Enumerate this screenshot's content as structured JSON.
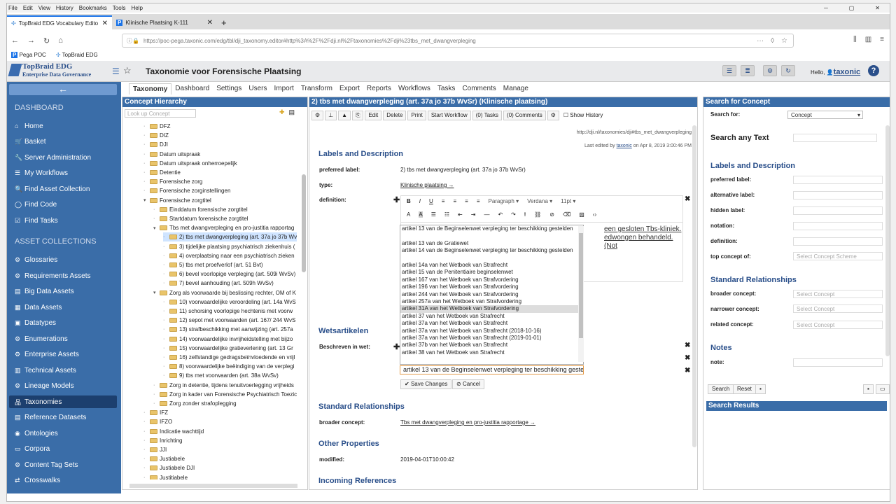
{
  "browser": {
    "menu": [
      "File",
      "Edit",
      "View",
      "History",
      "Bookmarks",
      "Tools",
      "Help"
    ],
    "tabs": [
      {
        "title": "TopBraid EDG Vocabulary Edito"
      },
      {
        "title": "Klinische Plaatsing K-111"
      }
    ],
    "new_tab": "+",
    "url": "https://poc-pega.taxonic.com/edg/tbl/dji_taxonomy.editor#http%3A%2F%2Fdji.nl%2Ftaxonomies%2Fdji%23tbs_met_dwangverpleging",
    "bookmarks": [
      "Pega POC",
      "TopBraid EDG"
    ]
  },
  "app": {
    "logo_line1": "TopBraid EDG",
    "logo_line2": "Enterprise Data Governance",
    "title": "Taxonomie voor Forensische Plaatsing",
    "hello": "Hello,",
    "user": "taxonic",
    "help": "?"
  },
  "sidebar": {
    "dashboard_head": "DASHBOARD",
    "dashboard": [
      "Home",
      "Basket",
      "Server Administration",
      "My Workflows",
      "Find Asset Collection",
      "Find Code",
      "Find Tasks"
    ],
    "collections_head": "ASSET COLLECTIONS",
    "collections": [
      "Glossaries",
      "Requirements Assets",
      "Big Data Assets",
      "Data Assets",
      "Datatypes",
      "Enumerations",
      "Enterprise Assets",
      "Technical Assets",
      "Lineage Models",
      "Taxonomies",
      "Reference Datasets",
      "Ontologies",
      "Corpora",
      "Content Tag Sets",
      "Crosswalks"
    ]
  },
  "topnav": [
    "Taxonomy",
    "Dashboard",
    "Settings",
    "Users",
    "Import",
    "Transform",
    "Export",
    "Reports",
    "Workflows",
    "Tasks",
    "Comments",
    "Manage"
  ],
  "hierarchy": {
    "title": "Concept Hierarchy",
    "lookup_placeholder": "Look up Concept",
    "nodes": [
      "DFZ",
      "DIZ",
      "DJI",
      "Datum uitspraak",
      "Datum uitspraak onherroepelijk",
      "Detentie",
      "Forensische zorg",
      "Forensische zorginstellingen",
      "Forensische zorgtitel",
      "Einddatum forensische zorgtitel",
      "Startdatum forensische zorgtitel",
      "Tbs met dwangverpleging en pro-justitia rapportag",
      "2) tbs met dwangverpleging (art. 37a jo 37b Wv",
      "3) tijdelijke plaatsing psychiatrisch ziekenhuis (",
      "4) overplaatsing naar een psychiatrisch zieken",
      "5) tbs met proefverlof (art. 51 Bvt)",
      "6) bevel voorlopige verpleging (art. 509i WvSv)",
      "7) bevel aanhouding (art. 509h WvSv)",
      "Zorg als voorwaarde bij beslissing rechter, OM of K",
      "10) voorwaardelijke veroordeling (art. 14a WvS",
      "11) schorsing voorlopige hechtenis met voorw",
      "12) sepot met voorwaarden (art. 167/ 244 WvS",
      "13) strafbeschikking met aanwijzing (art. 257a",
      "14) voorwaardelijke invrijheidstelling met bijzo",
      "15) voorwaardelijke gratieverlening (art. 13 Gr",
      "16) zelfstandige gedragsbeïnvloedende en vrijl",
      "8) voorwaardelijke beëindiging van de verplegi",
      "9) tbs met voorwaarden (art. 38a WvSv)",
      "Zorg in detentie, tijdens tenuitvoerlegging vrijheids",
      "Zorg in kader van Forensische Psychiatrisch Toezic",
      "Zorg zonder strafoplegging",
      "IFZ",
      "IFZO",
      "Indicatie wachttijd",
      "Inrichting",
      "JJI",
      "Justiabele",
      "Justiabele DJI",
      "Justitiabele"
    ]
  },
  "concept": {
    "header": "2) tbs met dwangverpleging (art. 37a jo 37b WvSr) (Klinische plaatsing)",
    "actions": [
      "Edit",
      "Delete",
      "Print",
      "Start Workflow",
      "(0) Tasks",
      "(0) Comments",
      "Show History"
    ],
    "uri": "http://dji.nl/taxonomies/dji#tbs_met_dwangverpleging",
    "edited_prefix": "Last edited by",
    "edited_user": "taxonic",
    "edited_suffix": "on Apr 8, 2019 3:00:46 PM",
    "labels_head": "Labels and Description",
    "pref_label_lbl": "preferred label:",
    "pref_label": "2) tbs met dwangverpleging (art. 37a jo 37b WvSr)",
    "type_lbl": "type:",
    "type": "Klinische plaatsing →",
    "definition_lbl": "definition:",
    "editor_paragraph": "Paragraph",
    "editor_font": "Verdana",
    "editor_size": "11pt",
    "def_text1": "een gesloten Tbs-kliniek.",
    "def_text2": "edwongen behandeld. (Not",
    "wets_head": "Wetsartikelen",
    "beschreven_lbl": "Beschreven in wet:",
    "dropdown": [
      "artikel 13 van de Beginselenwet verpleging ter beschikking gestelden",
      "artikel 13 van de Gratiewet",
      "artikel 14 van de Beginselenwet verpleging ter beschikking gestelden",
      "artikel 14a van het Wetboek van Strafrecht",
      "artikel 15 van de Penitentiaire beginselenwet",
      "artikel 167 van het Wetboek van Strafvordering",
      "artikel 196 van het Wetboek van Strafvordering",
      "artikel 244 van het Wetboek van Strafvordering",
      "artikel 257a van het Wetboek van Strafvordering",
      "artikel 31A van het Wetboek van Strafvordering",
      "artikel 37 van het Wetboek van Strafrecht",
      "artikel 37a van het Wetboek van Strafrecht",
      "artikel 37a van het Wetboek van Strafrecht (2018-10-16)",
      "artikel 37a van het Wetboek van Strafrecht (2019-01-01)",
      "artikel 37b van het Wetboek van Strafrecht",
      "artikel 38 van het Wetboek van Strafrecht"
    ],
    "selected_value": "artikel 13 van de Beginselenwet verpleging ter beschikking gestelden",
    "save_label": "Save Changes",
    "cancel_label": "Cancel",
    "std_rel_head": "Standard Relationships",
    "broader_lbl": "broader concept:",
    "broader": "Tbs met dwangverpleging en pro-justitia rapportage →",
    "other_head": "Other Properties",
    "modified_lbl": "modified:",
    "modified": "2019-04-01T10:00:42",
    "incoming_head": "Incoming References"
  },
  "search": {
    "title": "Search for Concept",
    "search_for_lbl": "Search for:",
    "search_for_val": "Concept",
    "any_text": "Search any Text",
    "labels_head": "Labels and Description",
    "fields": [
      "preferred label:",
      "alternative label:",
      "hidden label:",
      "notation:",
      "definition:",
      "top concept of:"
    ],
    "top_concept_placeholder": "Select Concept Scheme",
    "std_rel_head": "Standard Relationships",
    "rel_fields": [
      "broader concept:",
      "narrower concept:",
      "related concept:"
    ],
    "rel_placeholder": "Select Concept",
    "notes_head": "Notes",
    "note_lbl": "note:",
    "search_btn": "Search",
    "reset_btn": "Reset",
    "results_head": "Search Results"
  }
}
